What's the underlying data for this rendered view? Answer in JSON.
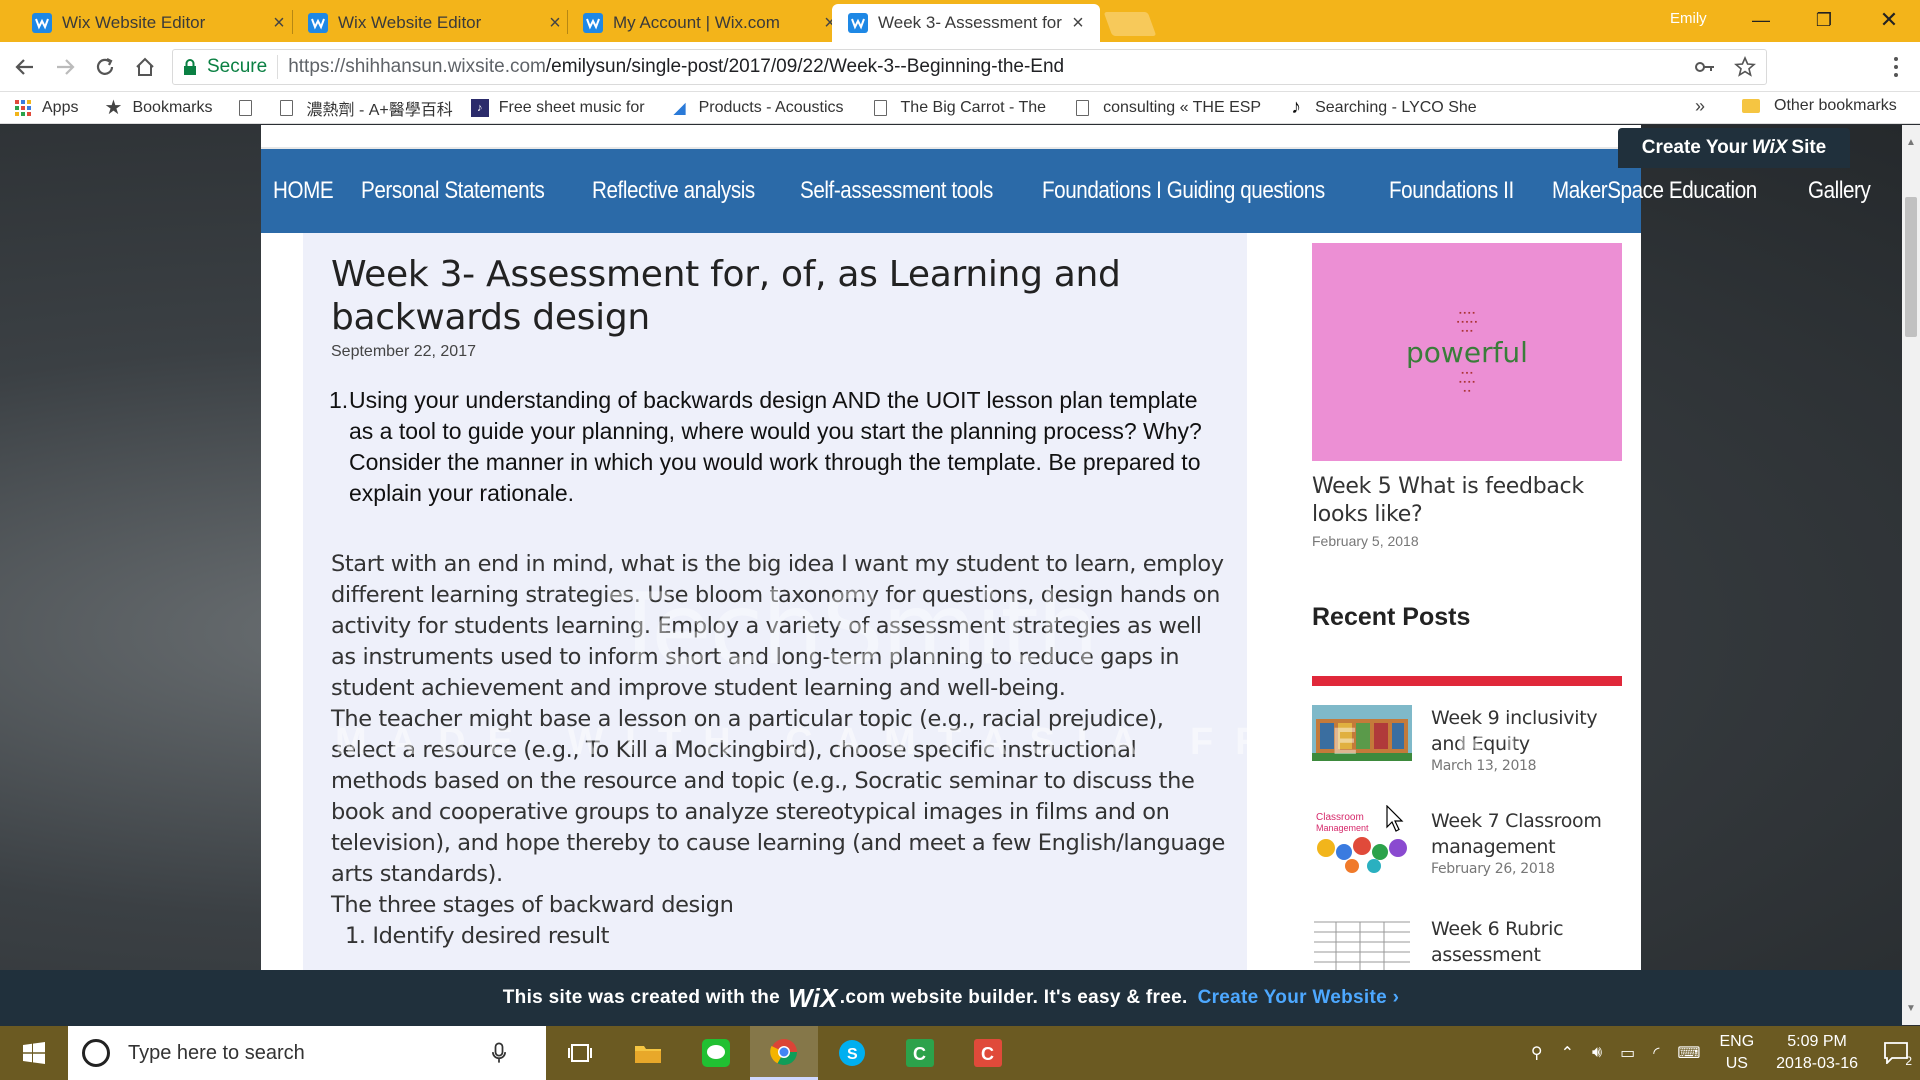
{
  "browser": {
    "tabs": [
      {
        "title": "Wix Website Editor",
        "active": false
      },
      {
        "title": "Wix Website Editor",
        "active": false
      },
      {
        "title": "My Account | Wix.com",
        "active": false
      },
      {
        "title": "Week 3- Assessment for",
        "active": true
      }
    ],
    "profile": "Emily",
    "secure_label": "Secure",
    "url_host": "https://shihhansun.wixsite.com",
    "url_path": "/emilysun/single-post/2017/09/22/Week-3--Beginning-the-End",
    "bookmarks": [
      "Apps",
      "Bookmarks",
      "",
      "濃熱劑 - A+醫學百科",
      "Free sheet music for",
      "Products - Acoustics",
      "The Big Carrot - The",
      "consulting « THE ESP",
      "Searching - LYCO She"
    ],
    "bookmarks_more": "»",
    "other_bookmarks": "Other bookmarks"
  },
  "site": {
    "create_site_pre": "Create Your",
    "create_site_logo": "WiX",
    "create_site_post": "Site",
    "nav": [
      "HOME",
      "Personal Statements",
      "Reflective analysis",
      "Self-assessment tools",
      "Foundations I Guiding questions",
      "Foundations II",
      "MakerSpace Education",
      "Gallery"
    ],
    "post": {
      "title": "Week 3- Assessment for, of, as Learning and backwards design",
      "date": "September 22, 2017",
      "question_num": "1.",
      "question": "Using your understanding of backwards design AND the UOIT lesson plan template as a tool to guide your planning, where would you start the planning process? Why? Consider the manner in which you would work through the template. Be prepared to explain your rationale.",
      "paragraphs": [
        " Start with an end in mind, what is the big idea I want my student to learn, employ different learning strategies. Use bloom taxonomy for questions, design hands on activity for students learning. Employ a variety of assessment strategies as well as instruments used to inform short and long-term planning to reduce gaps in student achievement and improve student learning and well-being.",
        "The teacher might base a lesson on a particular topic (e.g., racial prejudice), select a resource (e.g., To Kill a Mockingbird), choose specific instructional methods based on the resource and topic (e.g., Socratic seminar to discuss the book and cooperative groups to analyze stereotypical images in films and on television), and hope thereby to cause learning (and meet a few English/language arts standards).",
        "The three stages of backward design",
        "1. Identify desired result"
      ]
    },
    "sidebar": {
      "featured": {
        "cloud_word": "powerful",
        "title": "Week 5 What is feedback looks like?",
        "date": "February 5, 2018"
      },
      "recent_title": "Recent Posts",
      "recent": [
        {
          "title": "Week 9 inclusivity and Equity",
          "date": "March 13, 2018"
        },
        {
          "title": "Week 7 Classroom management",
          "date": "February 26, 2018"
        },
        {
          "title": "Week 6 Rubric assessment",
          "date": ""
        }
      ]
    },
    "watermark": "TechSmith",
    "watermark_sub": "MADE WITH CAMTASIA FREE TRIAL",
    "wix_banner": {
      "pre": "This site was created with the",
      "logo": "WiX",
      "post": ".com website builder. It's easy & free.",
      "link": "Create Your Website ›"
    }
  },
  "taskbar": {
    "search_placeholder": "Type here to search",
    "lang_top": "ENG",
    "lang_bottom": "US",
    "time": "5:09 PM",
    "date": "2018-03-16",
    "notification_count": "2"
  },
  "colors": {
    "chrome_accent": "#f3b41a",
    "site_nav": "#2b6aa8",
    "recent_bar": "#e0283a",
    "wix_link": "#4da8ff"
  }
}
